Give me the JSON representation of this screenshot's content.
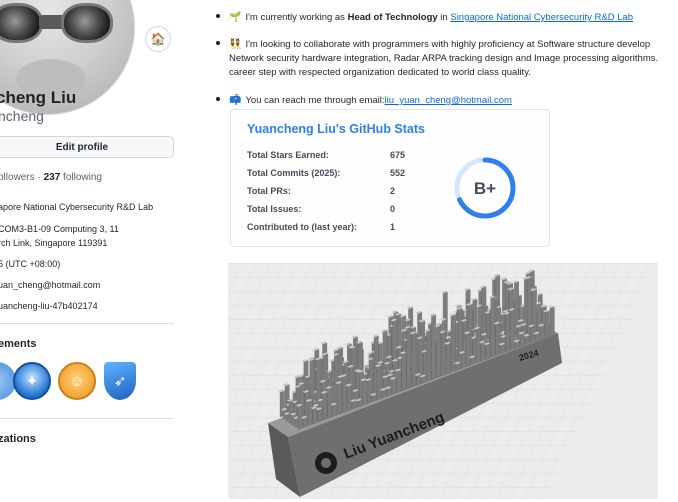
{
  "sidebar": {
    "fullname": "cheng Liu",
    "username": "ncheng",
    "status_emoji": "🏠",
    "edit_profile": "Edit profile",
    "followers_label": "ollowers · ",
    "following_count": "237",
    "following_label": " following",
    "company": "apore National Cybersecurity R&D Lab",
    "address_line1": "COM3-B1-09 Computing 3, 11",
    "address_line2": "rch Link, Singapore 119391",
    "timezone": "5 (UTC +08:00)",
    "email": "uan_cheng@hotmail.com",
    "linkedin": "uancheng-liu-47b402174",
    "achievements_heading": "ements",
    "organizations_heading": "zations"
  },
  "readme": {
    "line1_emoji": "🌱",
    "line1_prefix": "I'm currently working as ",
    "line1_bold": "Head of Technology",
    "line1_mid": " in ",
    "line1_link": "Singapore National Cybersecurity R&D Lab",
    "line2_emoji": "👯",
    "line2_a": "I'm looking to collaborate with programmers with highly proficiency at Software structure develop",
    "line2_b": "Network security hardware integration, Radar ARPA tracking design and Image processing algorithms.",
    "line2_c": "career step with respected organization dedicated to world class quality.",
    "line3_emoji": "📫",
    "line3_prefix": "You can reach me through email:",
    "line3_link": "liu_yuan_cheng@hotmail.com"
  },
  "stats": {
    "title": "Yuancheng Liu's GitHub Stats",
    "rows": [
      {
        "label": "Total Stars Earned:",
        "value": "675"
      },
      {
        "label": "Total Commits (2025):",
        "value": "552"
      },
      {
        "label": "Total PRs:",
        "value": "2"
      },
      {
        "label": "Total Issues:",
        "value": "0"
      },
      {
        "label": "Contributed to (last year):",
        "value": "1"
      }
    ],
    "rank": "B+",
    "rank_progress": 0.68,
    "accent_color": "#2f80ed"
  },
  "model3d": {
    "name_text": "Liu Yuancheng",
    "year_text": "2024"
  }
}
